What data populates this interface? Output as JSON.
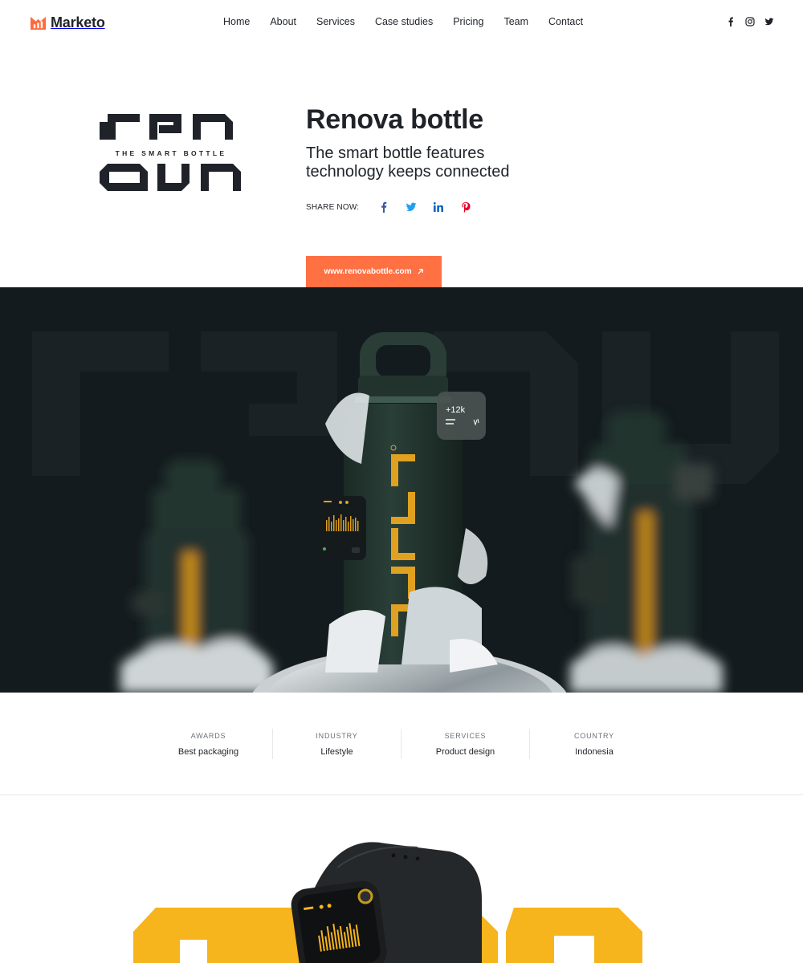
{
  "brand": {
    "name": "Marketo",
    "accent": "#ff6a3d"
  },
  "nav": {
    "items": [
      "Home",
      "About",
      "Services",
      "Case studies",
      "Pricing",
      "Team",
      "Contact"
    ]
  },
  "top_socials": [
    "facebook-icon",
    "instagram-icon",
    "twitter-icon"
  ],
  "hero": {
    "logo_tagline": "THE SMART BOTTLE",
    "title": "Renova bottle",
    "subtitle": "The smart bottle features technology keeps connected",
    "share_label": "SHARE NOW:",
    "share_icons": [
      {
        "name": "facebook-icon",
        "color": "#3b5998"
      },
      {
        "name": "twitter-icon",
        "color": "#1da1f2"
      },
      {
        "name": "linkedin-icon",
        "color": "#0a66c2"
      },
      {
        "name": "pinterest-icon",
        "color": "#e60023"
      }
    ],
    "cta_label": "www.renovabottle.com",
    "cta_color": "#ff7043"
  },
  "banner": {
    "stat_value": "+12k",
    "background": "#141b1e",
    "bottle_color": "#23352f",
    "logo_color": "#e0a020"
  },
  "info": [
    {
      "label": "AWARDS",
      "value": "Best packaging"
    },
    {
      "label": "INDUSTRY",
      "value": "Lifestyle"
    },
    {
      "label": "SERVICES",
      "value": "Product design"
    },
    {
      "label": "COUNTRY",
      "value": "Indonesia"
    }
  ],
  "bottom": {
    "accent": "#f6b41d"
  }
}
